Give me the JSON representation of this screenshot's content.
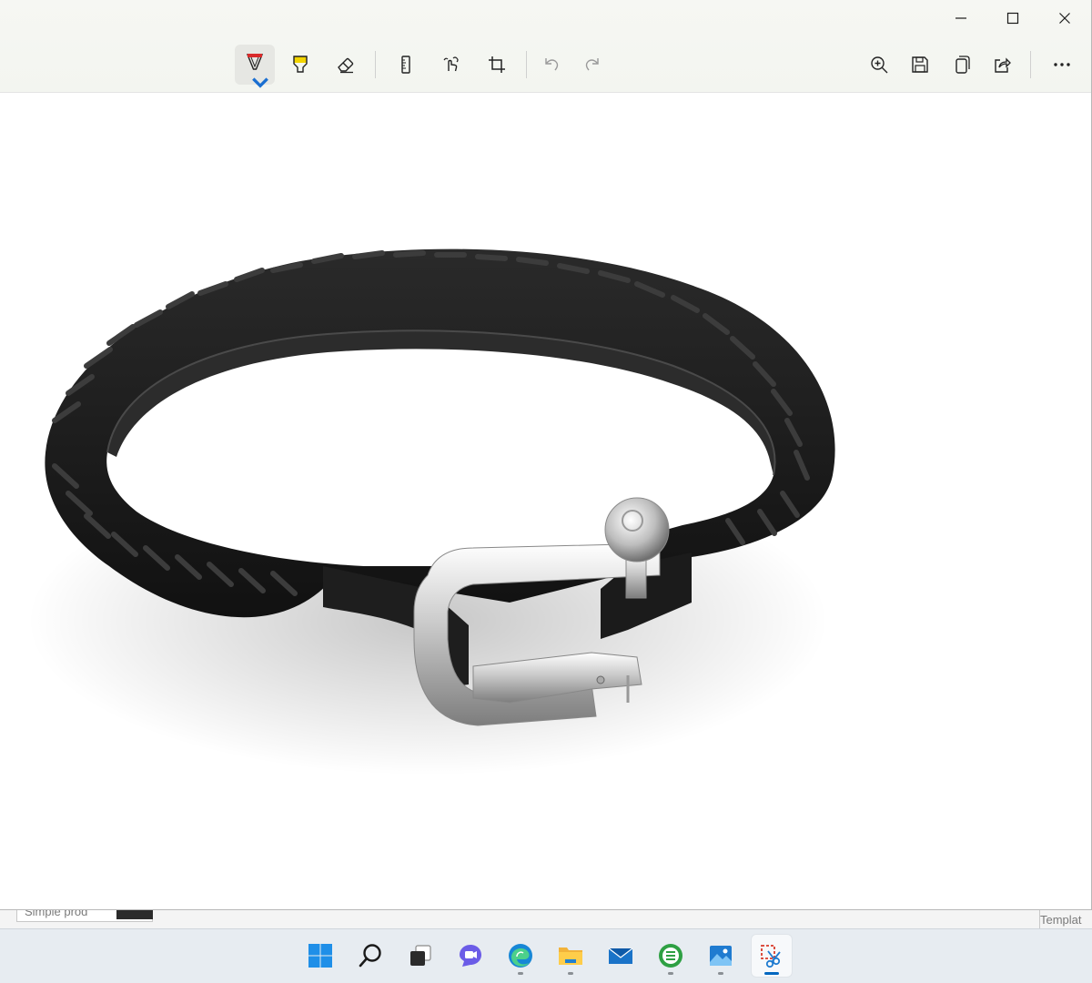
{
  "window": {
    "app": "Snipping Tool",
    "caption_buttons": [
      {
        "name": "minimize",
        "icon": "minimize-icon"
      },
      {
        "name": "maximize",
        "icon": "maximize-icon"
      },
      {
        "name": "close",
        "icon": "close-icon"
      }
    ]
  },
  "toolbar": {
    "tools": [
      {
        "name": "ballpoint-pen",
        "icon": "ballpoint-pen-icon",
        "color": "#d92b2b",
        "selected": true
      },
      {
        "name": "highlighter",
        "icon": "highlighter-icon",
        "color": "#f2d400"
      },
      {
        "name": "eraser",
        "icon": "eraser-icon"
      },
      {
        "name": "ruler",
        "icon": "ruler-icon"
      },
      {
        "name": "touch-writing",
        "icon": "touch-writing-icon"
      },
      {
        "name": "crop",
        "icon": "crop-icon"
      },
      {
        "name": "undo",
        "icon": "undo-icon",
        "enabled": false
      },
      {
        "name": "redo",
        "icon": "redo-icon",
        "enabled": false
      }
    ],
    "actions": [
      {
        "name": "zoom",
        "icon": "zoom-in-icon"
      },
      {
        "name": "save",
        "icon": "save-icon"
      },
      {
        "name": "copy",
        "icon": "copy-icon"
      },
      {
        "name": "share",
        "icon": "share-icon"
      },
      {
        "name": "more",
        "icon": "more-icon"
      }
    ]
  },
  "canvas": {
    "content": "screenshot of black braided leather bracelet with silver shackle clasp on white background"
  },
  "background_window": {
    "tab_text": "Simple prod",
    "right_text": "Templat"
  },
  "taskbar": {
    "apps": [
      {
        "name": "start",
        "icon": "windows-logo-icon",
        "running": false
      },
      {
        "name": "search",
        "icon": "search-icon",
        "running": false
      },
      {
        "name": "task-view",
        "icon": "task-view-icon",
        "running": false
      },
      {
        "name": "chat",
        "icon": "chat-icon",
        "running": false
      },
      {
        "name": "edge",
        "icon": "edge-icon",
        "running": true
      },
      {
        "name": "file-explorer",
        "icon": "folder-icon",
        "running": true
      },
      {
        "name": "mail",
        "icon": "mail-icon",
        "running": false
      },
      {
        "name": "app",
        "icon": "green-circle-app-icon",
        "running": true
      },
      {
        "name": "photos",
        "icon": "photos-icon",
        "running": true
      },
      {
        "name": "snipping-tool",
        "icon": "snipping-tool-icon",
        "running": true,
        "active": true
      }
    ],
    "accent": "#0067c0"
  }
}
